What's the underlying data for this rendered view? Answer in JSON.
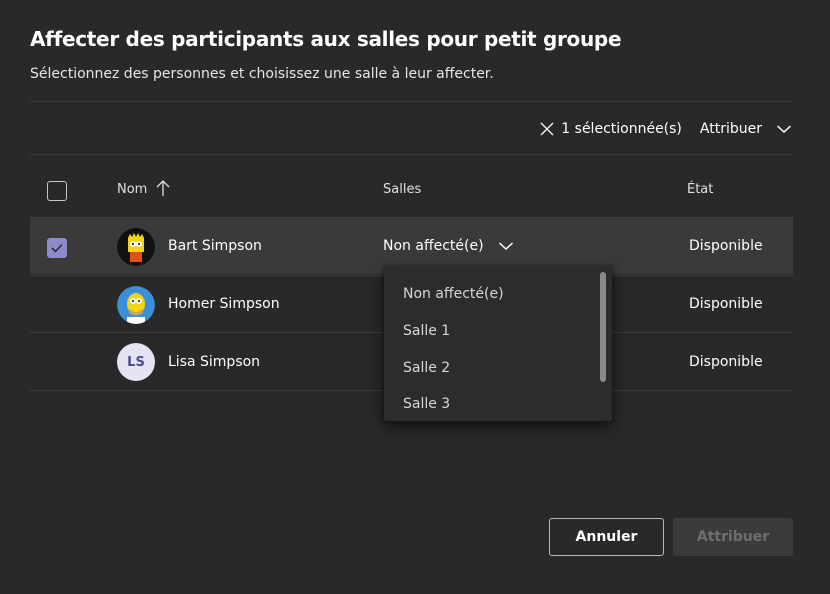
{
  "dialog": {
    "title": "Affecter des participants aux salles pour petit groupe",
    "subtitle": "Sélectionnez des personnes et choisissez une salle à leur affecter."
  },
  "toolbar": {
    "selection_label": "1 sélectionnée(s)",
    "assign_menu_label": "Attribuer"
  },
  "table": {
    "columns": {
      "name": "Nom",
      "rooms": "Salles",
      "state": "État"
    },
    "rows": [
      {
        "name": "Bart Simpson",
        "room": "Non affecté(e)",
        "state": "Disponible",
        "selected": true,
        "avatar": "bart-avatar"
      },
      {
        "name": "Homer Simpson",
        "room": "",
        "state": "Disponible",
        "selected": false,
        "avatar": "homer-avatar"
      },
      {
        "name": "Lisa Simpson",
        "room": "",
        "state": "Disponible",
        "selected": false,
        "avatar_initials": "LS"
      }
    ]
  },
  "room_dropdown": {
    "options": [
      "Non affecté(e)",
      "Salle 1",
      "Salle 2",
      "Salle 3"
    ]
  },
  "footer": {
    "cancel_label": "Annuler",
    "assign_label": "Attribuer"
  },
  "colors": {
    "background": "#292929",
    "selected_row": "#3b3a39",
    "checkbox_accent": "#8b8cc7",
    "dropdown_bg": "#2d2c2c",
    "disabled_button": "#3b3b3b"
  }
}
